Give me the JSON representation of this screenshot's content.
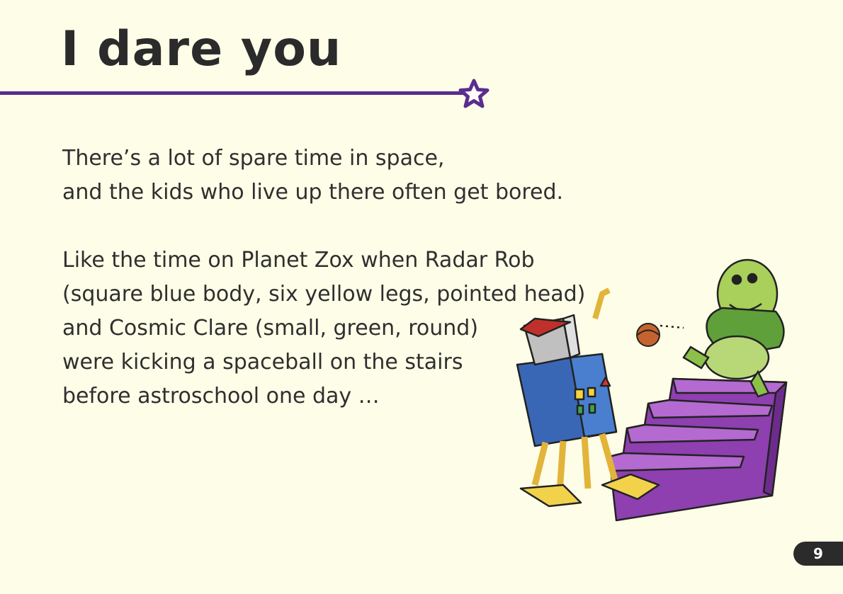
{
  "title": "I dare you",
  "paragraphs": [
    [
      "There’s a lot of spare time in space,",
      "and the kids who live up there often get bored."
    ],
    [
      "Like the time on Planet Zox when Radar Rob",
      "(square blue body, six yellow legs, pointed head)",
      "and Cosmic Clare (small, green, round)",
      "were kicking a spaceball on the stairs",
      "before astroschool one day …"
    ]
  ],
  "page_number": "9",
  "colors": {
    "accent": "#5b2d8e",
    "background": "#fefee8",
    "text": "#2b2b2b",
    "stairs": "#8e3fb0",
    "robot_body": "#3a67b5",
    "robot_legs": "#f2d24b",
    "alien": "#8cc04a"
  },
  "icons": [
    "star-icon"
  ]
}
